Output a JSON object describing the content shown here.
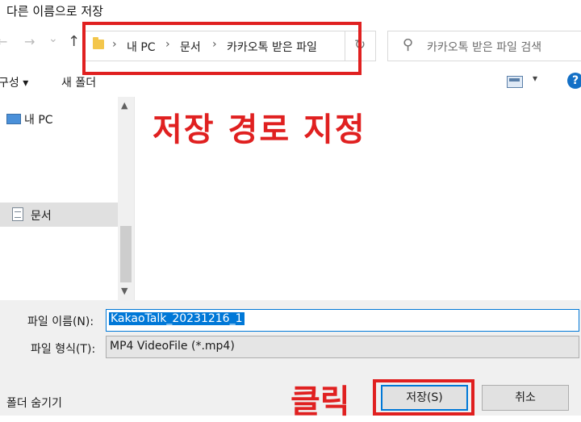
{
  "window": {
    "title": "다른 이름으로 저장"
  },
  "nav": {
    "back_glyph": "←",
    "forward_glyph": "→",
    "dropdown_glyph": "⌄",
    "up_glyph": "↑",
    "breadcrumb": [
      "내 PC",
      "문서",
      "카카오톡 받은 파일"
    ],
    "separator": "›",
    "refresh_glyph": "↻",
    "search_placeholder": "카카오톡 받은 파일 검색"
  },
  "toolbar": {
    "organize_label": "구성 ▾",
    "new_folder_label": "새 폴더",
    "view_dropdown": "▾",
    "help_label": "?"
  },
  "sidebar": {
    "items": [
      {
        "label": "내 PC",
        "icon": "pc-icon"
      },
      {
        "label": "문서",
        "icon": "document-icon",
        "selected": true
      }
    ]
  },
  "annotations": {
    "path_note": "저장 경로 지정",
    "click_note": "클릭",
    "color": "#e02020"
  },
  "form": {
    "filename_label": "파일 이름(N):",
    "filename_value": "KakaoTalk_20231216_1",
    "filetype_label": "파일 형식(T):",
    "filetype_value": "MP4 VideoFile (*.mp4)"
  },
  "footer": {
    "hide_folders_label": "폴더 숨기기",
    "save_label": "저장(S)",
    "cancel_label": "취소"
  }
}
